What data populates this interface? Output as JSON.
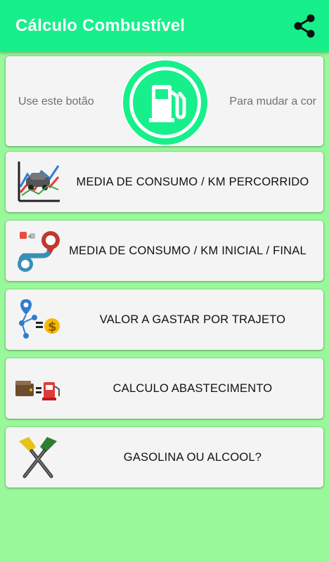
{
  "appbar": {
    "title": "Cálculo Combustível",
    "share_icon": "share-icon"
  },
  "color_section": {
    "left_hint": "Use este botão",
    "right_hint": "Para mudar a cor",
    "button_icon": "fuel-pump-icon",
    "ring_color": "#17ef8b"
  },
  "menu": [
    {
      "label": "MEDIA DE CONSUMO / KM PERCORRIDO",
      "icon": "consumption-chart-icon"
    },
    {
      "label": "MEDIA DE CONSUMO / KM INICIAL / FINAL",
      "icon": "route-map-icon"
    },
    {
      "label": "VALOR A GASTAR POR TRAJETO",
      "icon": "route-cost-icon"
    },
    {
      "label": "CALCULO ABASTECIMENTO",
      "icon": "wallet-fuel-icon"
    },
    {
      "label": "GASOLINA OU ALCOOL?",
      "icon": "fuel-nozzles-icon"
    }
  ],
  "colors": {
    "appbar": "#17ef8b",
    "background": "#99f99a",
    "card": "#f4f4f4"
  }
}
